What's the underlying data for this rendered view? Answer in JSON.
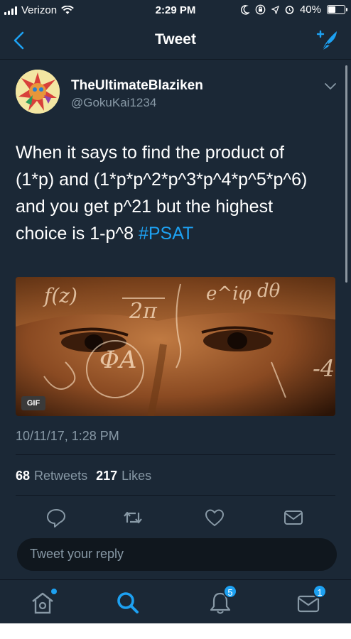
{
  "status_bar": {
    "carrier": "Verizon",
    "time": "2:29 PM",
    "battery": "40%",
    "battery_level": 0.4
  },
  "header": {
    "title": "Tweet",
    "back_icon": "chevron-left-icon",
    "compose_icon": "compose-tweet-icon"
  },
  "tweet": {
    "display_name": "TheUltimateBlaziken",
    "handle": "@GokuKai1234",
    "text_parts": {
      "line1": "When it says to find the product of",
      "line2": "(1*p) and (1*p*p^2*p^3*p^4*p^5*p^6)",
      "line3": "and you get p^21 but the highest",
      "line4_prefix": "choice is 1-p^8 ",
      "hashtag": "#PSAT"
    },
    "media": {
      "badge": "GIF",
      "overlay_text": [
        "f(z)",
        "2π",
        "e^iφ",
        "dθ",
        "ΦA",
        "-4"
      ]
    },
    "timestamp": "10/11/17, 1:28 PM",
    "retweets_count": "68",
    "retweets_label": "Retweets",
    "likes_count": "217",
    "likes_label": "Likes"
  },
  "actions": [
    "reply-icon",
    "retweet-icon",
    "like-icon",
    "direct-message-icon"
  ],
  "reply": {
    "placeholder": "Tweet your reply"
  },
  "tabbar": {
    "items": [
      "home-icon",
      "search-icon",
      "notifications-icon",
      "messages-icon"
    ],
    "notifications_badge": "5",
    "messages_badge": "1"
  },
  "colors": {
    "background": "#1b2836",
    "accent": "#1da1f2",
    "secondary_text": "#8899a6"
  }
}
